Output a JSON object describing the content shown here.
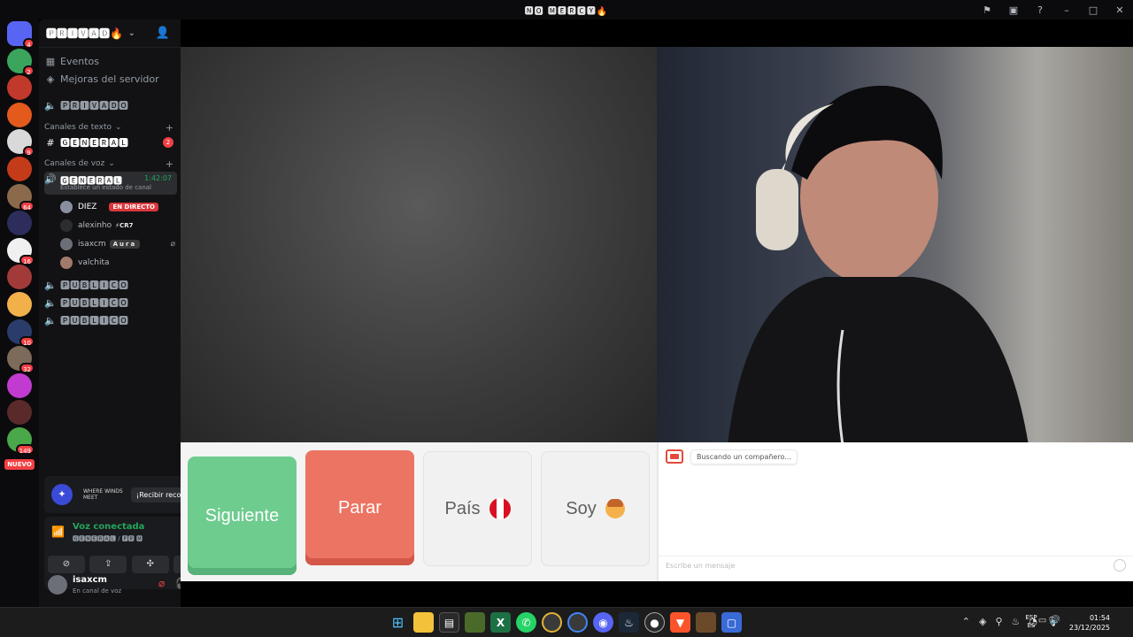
{
  "window": {
    "title": "🅽🅾 🅼🅴🆁🅲🆈🔥",
    "icons": [
      "inbox-icon",
      "window-icon",
      "help-icon",
      "minimize-icon",
      "maximize-icon",
      "close-icon"
    ]
  },
  "servers": [
    {
      "badge": "4",
      "color": "#5865f2"
    },
    {
      "badge": "2",
      "color": "#3ba55d"
    },
    {
      "badge": "",
      "color": "#c0392b"
    },
    {
      "badge": "",
      "color": "#e35a1c"
    },
    {
      "badge": "9",
      "color": "#d9d9d9"
    },
    {
      "badge": "",
      "color": "#c43b1a"
    },
    {
      "badge": "64",
      "color": "#8a6a4a"
    },
    {
      "badge": "",
      "color": "#2d2d5c"
    },
    {
      "badge": "16",
      "color": "#f0f0f0"
    },
    {
      "badge": "",
      "color": "#a33a3a"
    },
    {
      "badge": "",
      "color": "#f2b04a"
    },
    {
      "badge": "10",
      "color": "#2a3c6a"
    },
    {
      "badge": "32",
      "color": "#7c6a5a"
    },
    {
      "badge": "",
      "color": "#c23bd1"
    },
    {
      "badge": "",
      "color": "#5a2a2a"
    },
    {
      "badge": "149",
      "color": "#4aa84a"
    }
  ],
  "rail": {
    "new_label": "NUEVO"
  },
  "guild": {
    "name": "🅿🆁🅸🆅🅰🅳🔥"
  },
  "sidebar": {
    "events": "Eventos",
    "boosts": "Mejoras del servidor",
    "private_channel": "🅿🆁🅸🆅🅰🅳🅾",
    "text_category": "Canales de texto",
    "general_text": "🅶🅴🅽🅴🆁🅰🅻",
    "general_text_badge": "2",
    "voice_category": "Canales de voz",
    "general_voice": "🅶🅴🅽🅴🆁🅰🅻",
    "voice_timer": "1:42:07",
    "voice_status": "Establece un estado de canal",
    "voice_users": [
      {
        "name": "DIEZ",
        "tag": "",
        "live": "EN DIRECTO"
      },
      {
        "name": "alexinho",
        "tag": "⚡CR7",
        "live": ""
      },
      {
        "name": "isaxcm",
        "tag": "Aura",
        "live": ""
      },
      {
        "name": "valchita",
        "tag": "",
        "live": ""
      }
    ],
    "public_channels": [
      "🅿🆄🅱🅻🅸🅲🅾",
      "🅿🆄🅱🅻🅸🅲🅾",
      "🅿🆄🅱🅻🅸🅲🅾"
    ]
  },
  "promo": {
    "game": "WHERE WINDS MEET",
    "button": "¡Recibir recompen..."
  },
  "voice_panel": {
    "status": "Voz conectada",
    "channel": "🅶🅴🅽🅴🆁🅰🅻 / 🅿🆁 🅼"
  },
  "user_panel": {
    "name": "isaxcm",
    "status": "En canal de voz"
  },
  "omegle": {
    "next": "Siguiente",
    "stop": "Parar",
    "country": "País",
    "gender": "Soy",
    "searching": "Buscando un compañero...",
    "message_placeholder": "Escribe un mensaje"
  },
  "taskbar": {
    "lang_top": "ESP",
    "lang_bottom": "ES",
    "time": "01:54",
    "date": "23/12/2025"
  },
  "colors": {
    "next": "#6dcc8e",
    "stop": "#ec7462",
    "online": "#23a55a",
    "alert": "#f23f43"
  }
}
